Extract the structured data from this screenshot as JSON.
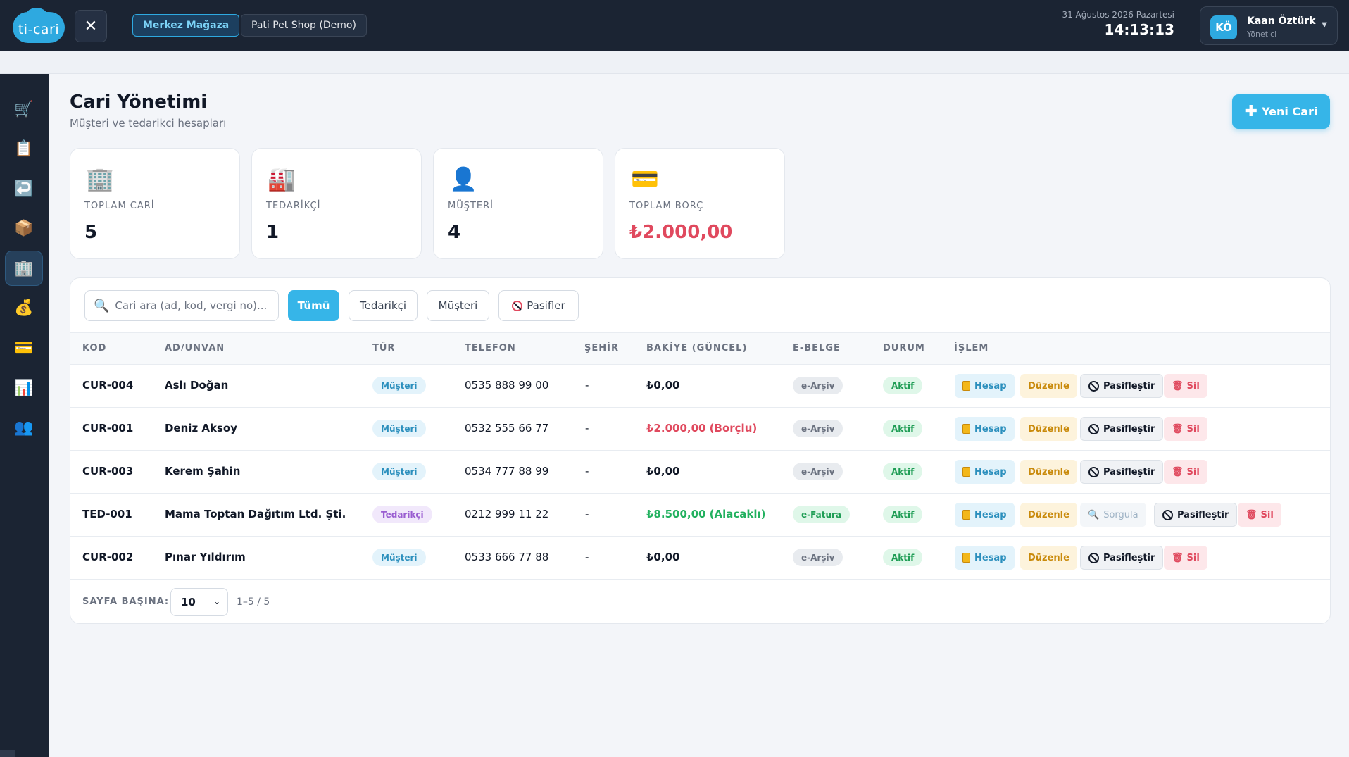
{
  "app": {
    "logo_text": "ti-cari"
  },
  "topbar": {
    "close_label": "✕",
    "stores": [
      "Merkez Mağaza",
      "Pati Pet Shop (Demo)"
    ],
    "date": "31 Ağustos 2026 Pazartesi",
    "time": "14:13:13",
    "user": {
      "initials": "KÖ",
      "name": "Kaan Öztürk",
      "role": "Yönetici"
    }
  },
  "sidebar": {
    "icons": [
      "cart-icon",
      "clipboard-icon",
      "return-icon",
      "package-icon",
      "building-icon",
      "money-bag-icon",
      "credit-card-icon",
      "chart-icon",
      "users-icon"
    ],
    "active_index": 4
  },
  "page": {
    "title": "Cari Yönetimi",
    "subtitle": "Müşteri ve tedarikci hesapları",
    "new_button": "Yeni Cari"
  },
  "stats": [
    {
      "label": "TOPLAM CARİ",
      "value": "5",
      "icon": "building-icon"
    },
    {
      "label": "TEDARİKÇİ",
      "value": "1",
      "icon": "factory-icon"
    },
    {
      "label": "MÜŞTERİ",
      "value": "4",
      "icon": "person-icon"
    },
    {
      "label": "TOPLAM BORÇ",
      "value": "₺2.000,00",
      "icon": "credit-card-icon"
    }
  ],
  "filters": {
    "search_placeholder": "Cari ara (ad, kod, vergi no)...",
    "buttons": [
      "Tümü",
      "Tedarikçi",
      "Müşteri",
      "Pasifler"
    ],
    "active": "Tümü"
  },
  "table": {
    "columns": [
      "KOD",
      "AD/UNVAN",
      "TÜR",
      "TELEFON",
      "ŞEHİR",
      "BAKİYE (GÜNCEL)",
      "E-BELGE",
      "DURUM",
      "İŞLEM"
    ],
    "rows": [
      {
        "code": "CUR-004",
        "name": "Aslı Doğan",
        "type": "Müşteri",
        "phone": "0535 888 99 00",
        "city": "-",
        "balance": "₺0,00",
        "doc": "e-Arşiv",
        "status": "Aktif"
      },
      {
        "code": "CUR-001",
        "name": "Deniz Aksoy",
        "type": "Müşteri",
        "phone": "0532 555 66 77",
        "city": "-",
        "balance": "₺2.000,00 (Borçlu)",
        "doc": "e-Arşiv",
        "status": "Aktif"
      },
      {
        "code": "CUR-003",
        "name": "Kerem Şahin",
        "type": "Müşteri",
        "phone": "0534 777 88 99",
        "city": "-",
        "balance": "₺0,00",
        "doc": "e-Arşiv",
        "status": "Aktif"
      },
      {
        "code": "TED-001",
        "name": "Mama Toptan Dağıtım Ltd. Şti.",
        "type": "Tedarikçi",
        "phone": "0212 999 11 22",
        "city": "-",
        "balance": "₺8.500,00 (Alacaklı)",
        "doc": "e-Fatura",
        "status": "Aktif"
      },
      {
        "code": "CUR-002",
        "name": "Pınar Yıldırım",
        "type": "Müşteri",
        "phone": "0533 666 77 88",
        "city": "-",
        "balance": "₺0,00",
        "doc": "e-Arşiv",
        "status": "Aktif"
      }
    ],
    "actions": {
      "account": "Hesap",
      "edit": "Düzenle",
      "query": "Sorgula",
      "deactivate": "Pasifleştir",
      "delete": "Sil"
    }
  },
  "pagination": {
    "per_page_label": "SAYFA BAŞINA:",
    "per_page": "10",
    "range": "1–5 / 5"
  },
  "colors": {
    "accent": "#36b5e8",
    "topbar": "#1b2433",
    "debt": "#e0495e",
    "credit": "#22b15f"
  }
}
